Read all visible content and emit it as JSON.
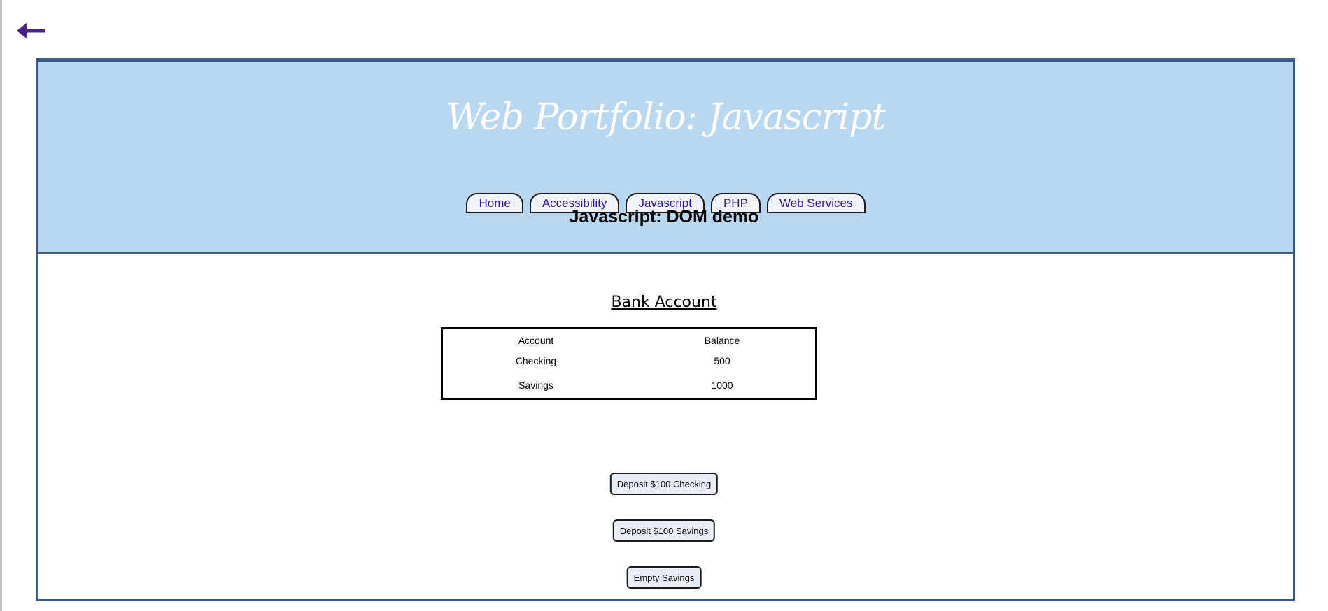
{
  "colors": {
    "header_bg": "#b8d7f1",
    "frame_border": "#3a5a8c",
    "nav_link": "#2a1a9c",
    "back_arrow": "#4b1f8c"
  },
  "back": {
    "icon": "left-arrow-icon"
  },
  "header": {
    "title": "Web Portfolio: Javascript"
  },
  "nav": [
    {
      "label": "Home"
    },
    {
      "label": "Accessibility"
    },
    {
      "label": "Javascript"
    },
    {
      "label": "PHP"
    },
    {
      "label": "Web Services"
    }
  ],
  "main": {
    "heading": "Javascript: DOM demo",
    "section_title": "Bank Account",
    "table": {
      "headers": [
        "Account",
        "Balance"
      ],
      "rows": [
        [
          "Checking",
          "500"
        ],
        [
          "Savings",
          "1000"
        ]
      ]
    },
    "buttons": {
      "deposit_checking": "Deposit $100 Checking",
      "deposit_savings": "Deposit $100 Savings",
      "empty_savings": "Empty Savings"
    }
  }
}
